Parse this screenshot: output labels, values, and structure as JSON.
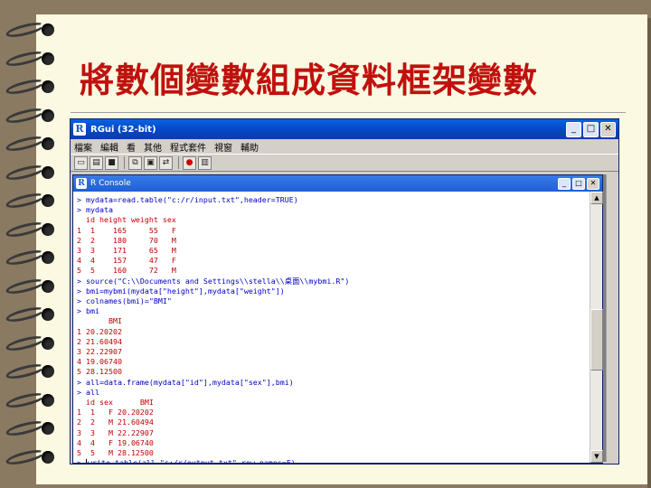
{
  "slide": {
    "title": "將數個變數組成資料框架變數"
  },
  "window": {
    "title": "RGui (32-bit)",
    "icon_letter": "R",
    "buttons": {
      "minimize": "_",
      "maximize": "□",
      "close": "✕"
    }
  },
  "menu": {
    "items": [
      "檔案",
      "編輯",
      "看",
      "其他",
      "程式套件",
      "視窗",
      "輔助"
    ]
  },
  "toolbar": {
    "icons": [
      "open-script-icon",
      "load-workspace-icon",
      "save-icon",
      "copy-icon",
      "paste-icon",
      "copy-paste-icon",
      "stop-icon",
      "print-icon"
    ]
  },
  "console": {
    "title": "R Console",
    "icon_letter": "R",
    "lines": [
      {
        "kind": "in",
        "text": "> mydata=read.table(\"c:/r/input.txt\",header=TRUE)"
      },
      {
        "kind": "in",
        "text": "> mydata"
      },
      {
        "kind": "out",
        "text": "  id height weight sex"
      },
      {
        "kind": "out",
        "text": "1  1    165     55   F"
      },
      {
        "kind": "out",
        "text": "2  2    180     70   M"
      },
      {
        "kind": "out",
        "text": "3  3    171     65   M"
      },
      {
        "kind": "out",
        "text": "4  4    157     47   F"
      },
      {
        "kind": "out",
        "text": "5  5    160     72   M"
      },
      {
        "kind": "in",
        "text": "> source(\"C:\\\\Documents and Settings\\\\stella\\\\桌面\\\\mybmi.R\")"
      },
      {
        "kind": "in",
        "text": "> bmi=mybmi(mydata[\"height\"],mydata[\"weight\"])"
      },
      {
        "kind": "in",
        "text": "> colnames(bmi)=\"BMI\""
      },
      {
        "kind": "in",
        "text": "> bmi"
      },
      {
        "kind": "out",
        "text": "       BMI"
      },
      {
        "kind": "out",
        "text": "1 20.20202"
      },
      {
        "kind": "out",
        "text": "2 21.60494"
      },
      {
        "kind": "out",
        "text": "3 22.22907"
      },
      {
        "kind": "out",
        "text": "4 19.06740"
      },
      {
        "kind": "out",
        "text": "5 28.12500"
      },
      {
        "kind": "in",
        "text": "> all=data.frame(mydata[\"id\"],mydata[\"sex\"],bmi)"
      },
      {
        "kind": "in",
        "text": "> all"
      },
      {
        "kind": "out",
        "text": "  id sex      BMI"
      },
      {
        "kind": "out",
        "text": "1  1   F 20.20202"
      },
      {
        "kind": "out",
        "text": "2  2   M 21.60494"
      },
      {
        "kind": "out",
        "text": "3  3   M 22.22907"
      },
      {
        "kind": "out",
        "text": "4  4   F 19.06740"
      },
      {
        "kind": "out",
        "text": "5  5   M 28.12500"
      },
      {
        "kind": "cur",
        "text": "write.table(all,\"c:/r/output.txt\",row.names=F)"
      }
    ]
  },
  "scrollbar": {
    "up": "▲",
    "down": "▼"
  }
}
